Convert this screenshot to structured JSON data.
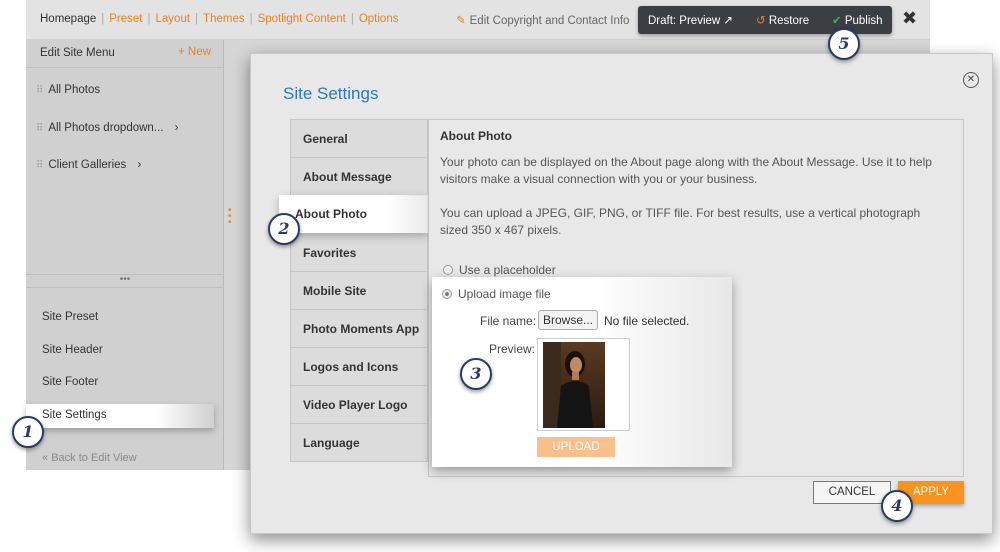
{
  "topbar": {
    "nav": [
      "Homepage",
      "Preset",
      "Layout",
      "Themes",
      "Spotlight Content",
      "Options"
    ],
    "copyright": "Edit Copyright and Contact Info",
    "draft_preview": "Draft: Preview",
    "restore": "Restore",
    "publish": "Publish"
  },
  "sidebar": {
    "title": "Edit Site Menu",
    "new_label": "+ New",
    "items": [
      {
        "label": "All Photos"
      },
      {
        "label": "All Photos dropdown..."
      },
      {
        "label": "Client Galleries"
      }
    ],
    "ellipsis": "•••",
    "lower_items": [
      "Site Preset",
      "Site Header",
      "Site Footer",
      "Site Settings"
    ],
    "back_label": "Back to Edit View"
  },
  "dialog": {
    "title": "Site Settings",
    "tabs": [
      "General",
      "About Message",
      "About Photo",
      "Favorites",
      "Mobile Site",
      "Photo Moments App",
      "Logos and Icons",
      "Video Player Logo",
      "Language"
    ],
    "active_tab": "About Photo",
    "content": {
      "heading": "About Photo",
      "para1": "Your photo can be displayed on the About page along with the About Message. Use it to help visitors make a visual connection with you or your business.",
      "para2": "You can upload a JPEG, GIF, PNG, or TIFF file. For best results, use a vertical photograph sized 350 x 467 pixels.",
      "option_placeholder": "Use a placeholder",
      "option_upload": "Upload image file",
      "file_name_label": "File name:",
      "browse_label": "Browse...",
      "no_file": "No file selected.",
      "preview_label": "Preview:",
      "upload_label": "UPLOAD"
    },
    "cancel_label": "CANCEL",
    "apply_label": "APPLY"
  },
  "badges": [
    "1",
    "2",
    "3",
    "4",
    "5"
  ],
  "colors": {
    "accent": "#e8821e",
    "title_blue": "#2a7ab8",
    "apply": "#f7931e",
    "badge": "#2b3a6b"
  }
}
